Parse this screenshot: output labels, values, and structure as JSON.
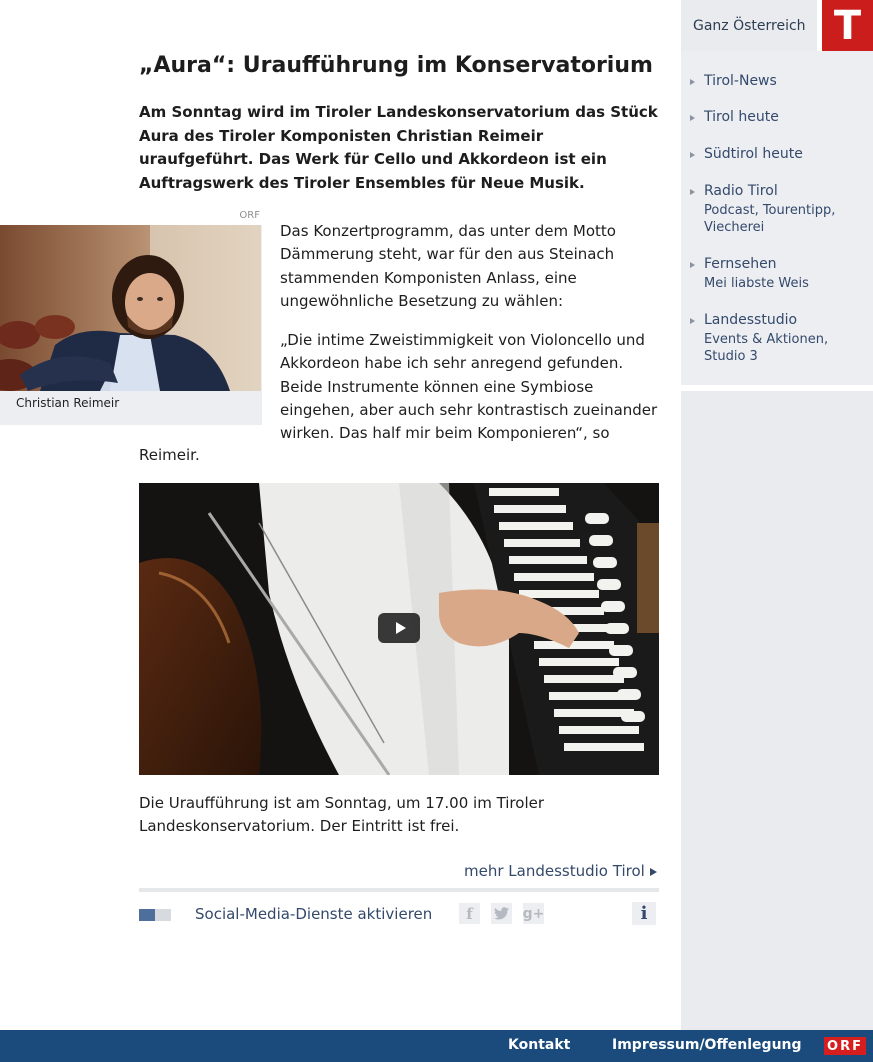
{
  "header": {
    "region_label": "Ganz Österreich",
    "logo_letter": "T"
  },
  "sidebar": {
    "items": [
      {
        "title": "Tirol-News",
        "sub": ""
      },
      {
        "title": "Tirol heute",
        "sub": ""
      },
      {
        "title": "Südtirol heute",
        "sub": ""
      },
      {
        "title": "Radio Tirol",
        "sub": "Podcast, Tourentipp, Viecherei"
      },
      {
        "title": "Fernsehen",
        "sub": "Mei liabste Weis"
      },
      {
        "title": "Landesstudio",
        "sub": "Events & Aktionen, Studio 3"
      }
    ]
  },
  "article": {
    "title": "„Aura“: Uraufführung im Konservatorium",
    "lead": "Am Sonntag wird im Tiroler Landeskonservatorium das Stück Aura des Tiroler Komponisten Christian Reimeir uraufgeführt. Das Werk für Cello und Akkordeon ist ein Auftragswerk des Tiroler Ensembles für Neue Musik.",
    "photo_credit": "ORF",
    "photo_caption": "Christian Reimeir",
    "paragraph1": "Das Konzertprogramm, das unter dem Motto Dämmerung steht, war für den aus Steinach stammenden Komponisten Anlass, eine ungewöhnliche Besetzung zu wählen:",
    "paragraph2": "„Die intime Zweistimmigkeit von Violoncello und Akkordeon habe ich sehr anregend gefunden. Beide Instrumente können eine Symbiose eingehen, aber auch sehr kontrastisch zueinander wirken. Das half mir beim Komponieren“, so",
    "paragraph2_end": "Reimeir.",
    "paragraph3": "Die Uraufführung ist am Sonntag, um 17.00 im Tiroler Landeskonservatorium. Der Eintritt ist frei.",
    "more_link": "mehr Landesstudio Tirol"
  },
  "social": {
    "label": "Social-Media-Dienste aktivieren",
    "facebook_glyph": "f",
    "googleplus_glyph": "g+",
    "info_glyph": "i"
  },
  "footer": {
    "kontakt": "Kontakt",
    "impressum": "Impressum/Offenlegung",
    "orf_logo": "ORF"
  },
  "colors": {
    "brand_red": "#cc1d1d",
    "link_blue": "#34496c",
    "footer_blue": "#1b4b7d",
    "sidebar_grey": "#e9ebee"
  }
}
